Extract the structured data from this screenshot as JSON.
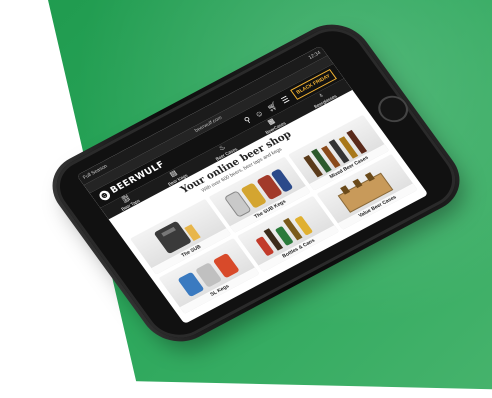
{
  "phone": {
    "status_left": "Full Season",
    "status_right": "12:34",
    "url": "beerwulf.com"
  },
  "header": {
    "logo_text": "BEERWULF",
    "black_friday": "BLACK FRIDAY",
    "icons": [
      "search-icon",
      "user-icon",
      "cart-icon",
      "menu-icon"
    ]
  },
  "nav": {
    "items": [
      {
        "label": "Beer Taps",
        "icon": "tap-icon"
      },
      {
        "label": "Beer Kegs",
        "icon": "keg-icon"
      },
      {
        "label": "Beer Cases",
        "icon": "case-icon"
      },
      {
        "label": "BeerCases",
        "icon": "crate-icon"
      },
      {
        "label": "Beerglasses",
        "icon": "glass-icon"
      }
    ]
  },
  "hero": {
    "title": "Your online beer shop",
    "subtitle": "With over 600 beers, beer taps and kegs"
  },
  "categories": [
    {
      "label": "The SUB"
    },
    {
      "label": "The SUB Kegs"
    },
    {
      "label": "Mixed Beer Cases"
    },
    {
      "label": "SL Kegs"
    },
    {
      "label": "Bottles & Cans"
    },
    {
      "label": "Value Beer Cases"
    }
  ],
  "colors": {
    "background_green": "#2aa65a",
    "accent_gold": "#f2b232",
    "header_black": "#111111"
  }
}
